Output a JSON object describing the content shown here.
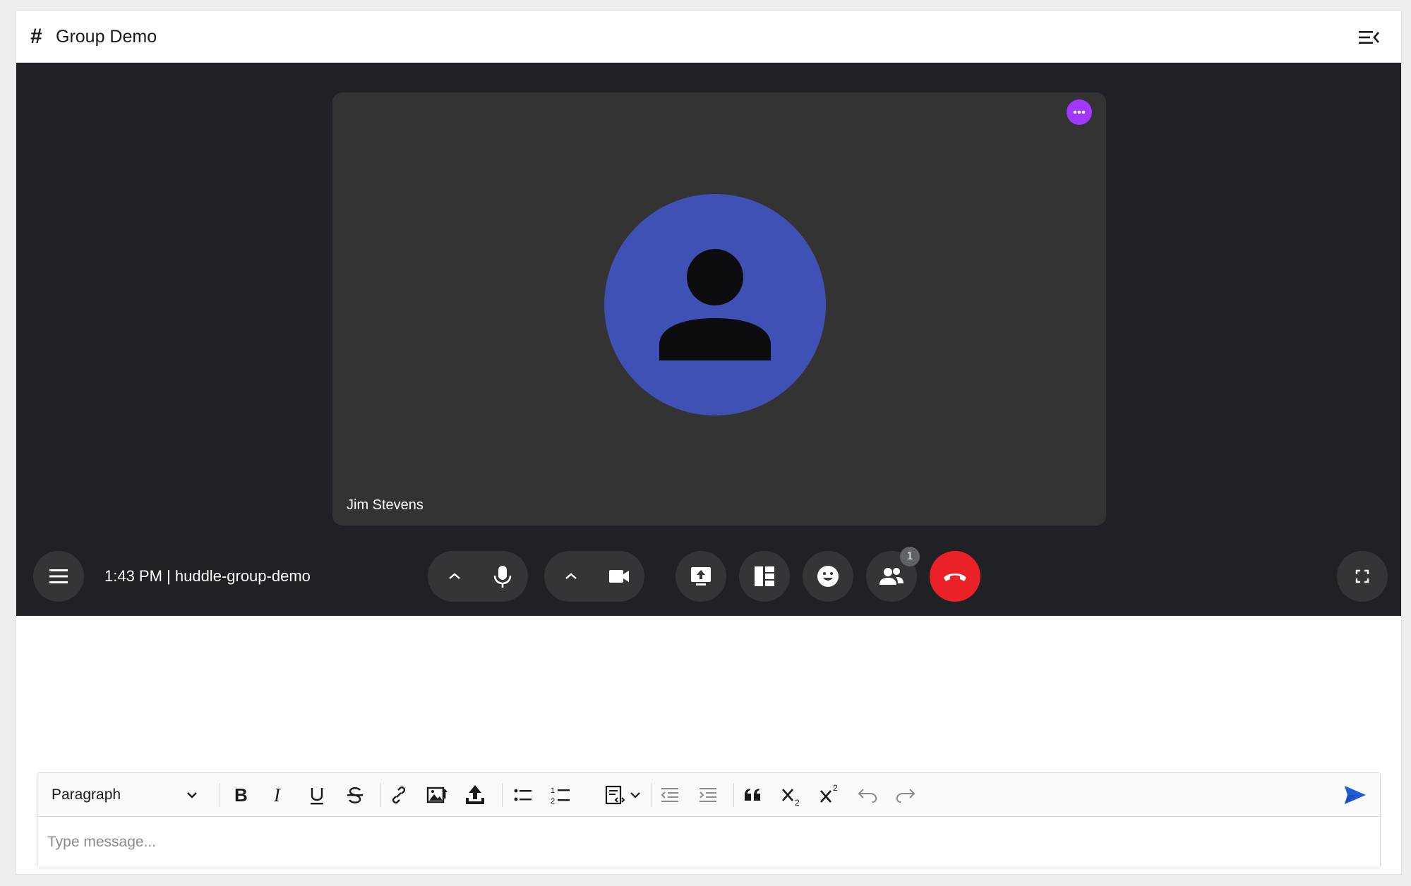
{
  "header": {
    "channel_prefix": "#",
    "title": "Group Demo",
    "menu_icon": "sidebar-collapse-icon"
  },
  "call": {
    "participant": {
      "name": "Jim Stevens",
      "avatar_icon": "person-icon",
      "avatar_color": "#3f51b5",
      "more_icon": "ellipsis-icon",
      "more_color": "#a238ff"
    },
    "meeting_info": "1:43 PM | huddle-group-demo",
    "controls": {
      "menu_icon": "hamburger-icon",
      "audio_options_icon": "chevron-up-icon",
      "mic_icon": "microphone-icon",
      "video_options_icon": "chevron-up-icon",
      "camera_icon": "video-camera-icon",
      "share_screen_icon": "screen-share-icon",
      "layout_icon": "layout-icon",
      "reactions_icon": "smiley-icon",
      "participants_icon": "people-icon",
      "participants_count": "1",
      "end_call_icon": "hang-up-icon",
      "end_call_color": "#ea2127",
      "fullscreen_icon": "fullscreen-icon"
    }
  },
  "editor": {
    "block_format": "Paragraph",
    "placeholder": "Type message...",
    "toolbar_icons": [
      "bold-icon",
      "italic-icon",
      "underline-icon",
      "strikethrough-icon",
      "link-icon",
      "insert-image-icon",
      "upload-icon",
      "bullet-list-icon",
      "numbered-list-icon",
      "code-block-icon",
      "outdent-icon",
      "indent-icon",
      "blockquote-icon",
      "subscript-icon",
      "superscript-icon",
      "undo-icon",
      "redo-icon"
    ],
    "send_icon": "send-icon",
    "send_color": "#1f5bd6"
  }
}
